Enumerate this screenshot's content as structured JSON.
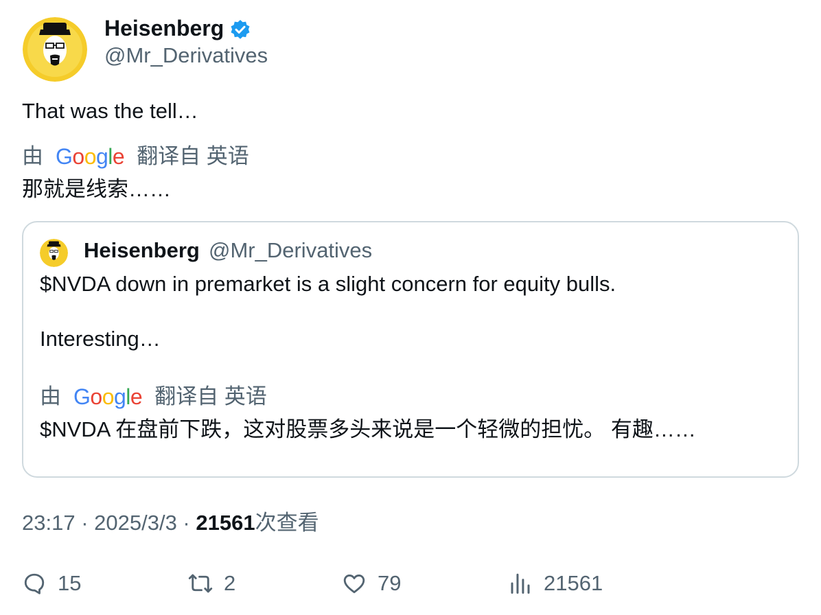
{
  "author": {
    "name": "Heisenberg",
    "handle": "@Mr_Derivatives",
    "verified": true,
    "avatar_icon": "heisenberg-avatar",
    "verified_color": "#1d9bf0"
  },
  "tweet": {
    "text": "That was the tell…",
    "translation": {
      "by_label": "由",
      "provider": "Google",
      "from_label": "翻译自 英语",
      "text": "那就是线索……"
    }
  },
  "quote": {
    "name": "Heisenberg",
    "handle": "@Mr_Derivatives",
    "line1": "$NVDA down in premarket is a slight concern for equity bulls.",
    "line2": "Interesting…",
    "translation": {
      "by_label": "由",
      "provider": "Google",
      "from_label": "翻译自 英语",
      "text": "$NVDA 在盘前下跌，这对股票多头来说是一个轻微的担忧。 有趣……"
    }
  },
  "meta": {
    "time": "23:17",
    "sep1": " · ",
    "date": "2025/3/3",
    "sep2": " · ",
    "views": "21561",
    "views_label": "次查看"
  },
  "actions": {
    "replies": "15",
    "retweets": "2",
    "likes": "79",
    "views": "21561"
  },
  "colors": {
    "text": "#0f1419",
    "secondary": "#536471",
    "border": "#cfd9de",
    "avatar_bg": "#f5cc2a"
  }
}
